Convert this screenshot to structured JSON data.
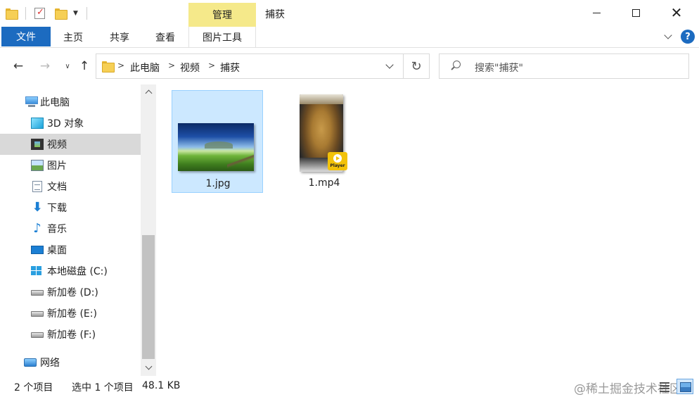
{
  "window": {
    "title": "捕获",
    "contextual_tab_group": "管理"
  },
  "ribbon": {
    "tabs": [
      {
        "label": "文件"
      },
      {
        "label": "主页"
      },
      {
        "label": "共享"
      },
      {
        "label": "查看"
      },
      {
        "label": "图片工具"
      }
    ],
    "help_label": "?"
  },
  "address": {
    "crumbs": [
      "此电脑",
      "视频",
      "捕获"
    ],
    "separator": ">",
    "search_placeholder": "搜索\"捕获\""
  },
  "nav_pane": {
    "items": [
      {
        "label": "此电脑",
        "icon": "computer-icon"
      },
      {
        "label": "3D 对象",
        "icon": "3d-objects-icon"
      },
      {
        "label": "视频",
        "icon": "video-folder-icon",
        "selected": true
      },
      {
        "label": "图片",
        "icon": "pictures-icon"
      },
      {
        "label": "文档",
        "icon": "documents-icon"
      },
      {
        "label": "下载",
        "icon": "download-icon"
      },
      {
        "label": "音乐",
        "icon": "music-icon"
      },
      {
        "label": "桌面",
        "icon": "desktop-icon"
      },
      {
        "label": "本地磁盘 (C:)",
        "icon": "drive-c-icon"
      },
      {
        "label": "新加卷 (D:)",
        "icon": "drive-icon"
      },
      {
        "label": "新加卷 (E:)",
        "icon": "drive-icon"
      },
      {
        "label": "新加卷 (F:)",
        "icon": "drive-icon"
      },
      {
        "label": "网络",
        "icon": "network-icon"
      }
    ]
  },
  "files": [
    {
      "name": "1.jpg",
      "type": "image",
      "selected": true
    },
    {
      "name": "1.mp4",
      "type": "video",
      "badge": "Player"
    }
  ],
  "status": {
    "item_count": "2 个项目",
    "selected_count": "选中 1 个项目",
    "selected_size": "48.1 KB",
    "watermark": "@稀土掘金技术社区"
  },
  "colors": {
    "file_tab": "#1c6bc0",
    "contextual_tab": "#f5e98a",
    "selection": "#cce8ff",
    "selection_border": "#99d1ff",
    "nav_selected": "#d9d9d9"
  }
}
